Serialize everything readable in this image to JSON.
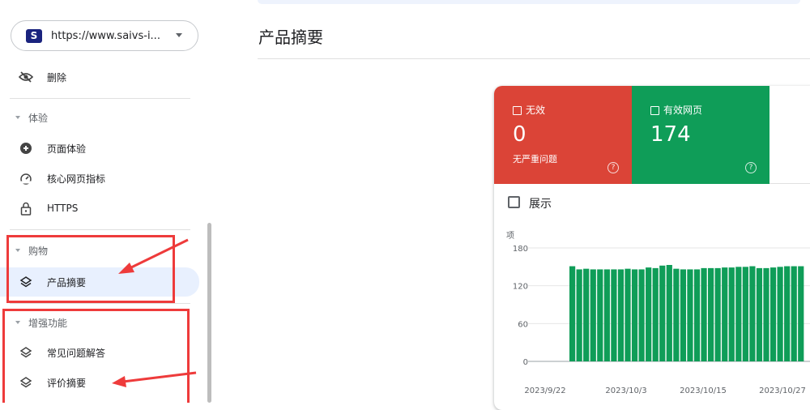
{
  "property": {
    "logo": "S",
    "url": "https://www.saivs-i..."
  },
  "nav": {
    "remove": "删除",
    "experience_section": "体验",
    "page_experience": "页面体验",
    "core_web_vitals": "核心网页指标",
    "https": "HTTPS",
    "shopping_section": "购物",
    "product_snippets": "产品摘要",
    "enhancements_section": "增强功能",
    "faq": "常见问题解答",
    "review_snippets": "评价摘要"
  },
  "page": {
    "title": "产品摘要"
  },
  "summary": {
    "invalid": {
      "label": "无效",
      "value": "0",
      "sub": "无严重问题",
      "help": "?"
    },
    "valid": {
      "label": "有效网页",
      "value": "174",
      "help": "?"
    },
    "show_label": "展示"
  },
  "colors": {
    "invalid": "#db4437",
    "valid": "#0f9d58",
    "annotation": "#ee3b3b",
    "active_bg": "#e8f0fe"
  },
  "chart_data": {
    "type": "bar",
    "ylabel": "项",
    "yticks": [
      0,
      60,
      120,
      180
    ],
    "ylim": [
      0,
      180
    ],
    "xticks": [
      "2023/9/22",
      "2023/10/3",
      "2023/10/15",
      "2023/10/27"
    ],
    "series": [
      {
        "color": "#0f9d58",
        "values": [
          151,
          146,
          147,
          146,
          146,
          146,
          146,
          146,
          147,
          146,
          146,
          149,
          148,
          152,
          153,
          147,
          146,
          146,
          146,
          148,
          148,
          148,
          149,
          149,
          150,
          150,
          151,
          148,
          148,
          149,
          150,
          151,
          151,
          151
        ]
      }
    ]
  }
}
